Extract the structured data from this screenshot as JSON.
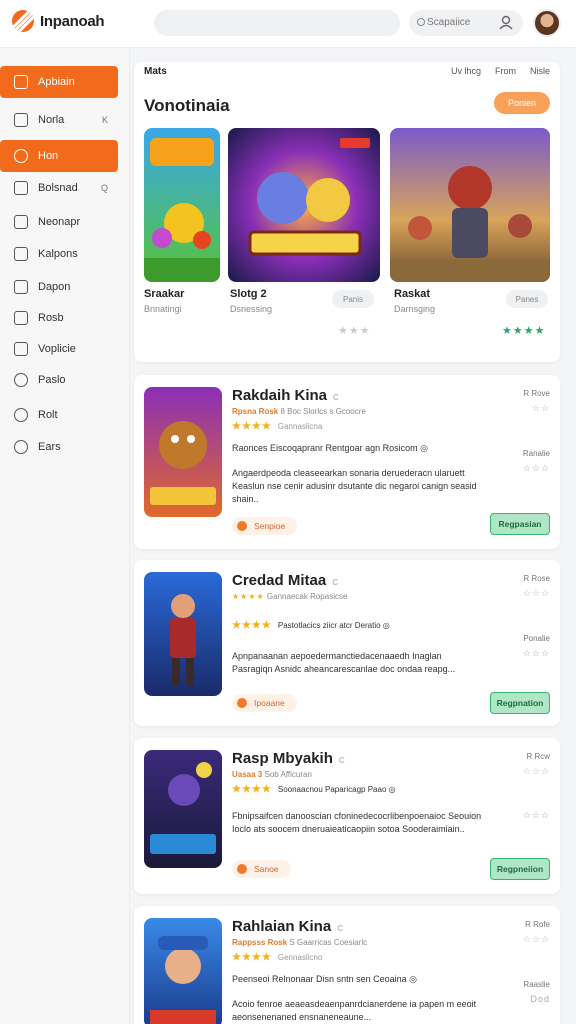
{
  "header": {
    "app_title": "Inpanoah",
    "search_placeholder": "Scapaiice"
  },
  "sidebar": {
    "items": [
      {
        "label": "Apbiain",
        "icon": "home-icon",
        "active": true,
        "sub": ""
      },
      {
        "label": "Norla",
        "icon": "grid-icon",
        "active": false,
        "sub": "K"
      },
      {
        "label": "Hon",
        "icon": "game-icon",
        "active": true,
        "sub": ""
      },
      {
        "label": "Bolsnad",
        "icon": "folder-icon",
        "active": false,
        "sub": "Q"
      },
      {
        "label": "Neonapr",
        "icon": "document-icon",
        "active": false,
        "sub": ""
      },
      {
        "label": "Kalpons",
        "icon": "puzzle-icon",
        "active": false,
        "sub": ""
      },
      {
        "label": "Dapon",
        "icon": "chat-icon",
        "active": false,
        "sub": ""
      },
      {
        "label": "Rosb",
        "icon": "chart-icon",
        "active": false,
        "sub": ""
      },
      {
        "label": "Voplicie",
        "icon": "square-icon",
        "active": false,
        "sub": ""
      },
      {
        "label": "Paslo",
        "icon": "camera-icon",
        "active": false,
        "sub": ""
      },
      {
        "label": "Rolt",
        "icon": "circle-icon",
        "active": false,
        "sub": ""
      },
      {
        "label": "Ears",
        "icon": "settings-icon",
        "active": false,
        "sub": ""
      }
    ]
  },
  "featured": {
    "nav_left": "Mats",
    "nav_right": [
      "Uv lhcg",
      "From",
      "Nisle"
    ],
    "title": "Vonotinaia",
    "button": "Ponien",
    "tiles": [
      {
        "name": "Sraakar",
        "sub": "Bnnatingi",
        "tag": "",
        "stars": ""
      },
      {
        "name": "Slotg 2",
        "sub": "Dsnessing",
        "tag": "Panis",
        "stars": "★★★"
      },
      {
        "name": "Raskat",
        "sub": "Darnsging",
        "tag": "Panes",
        "stars": "★★★★"
      }
    ]
  },
  "cards": [
    {
      "title": "Rakdaih Kina",
      "title_tag": "C",
      "meta_accent": "Rpsna Rosk",
      "meta_rest": "8  Boc Slorlcs  s Gcoocre",
      "rating": "★★★★",
      "rating_label": "Gannaslicna",
      "line": "Raonces Eiscoqapranr Rentgoar agn Rosicom ◎",
      "desc": "Angaerdpeoda cleaseearkan sonaria deruederacn ularuett Keaslun nse cenir adusinr dsutante dic negaroi canign seasid shain..",
      "chip": "Senpioe",
      "right1": "R Rove",
      "right1_stars": "☆☆",
      "right2": "Ranalie",
      "right2_stars": "☆☆☆",
      "cta": "Regpasian"
    },
    {
      "title": "Credad Mitaa",
      "title_tag": "C",
      "meta_accent": "",
      "meta_rest": "Gannaecak    Ropasicse",
      "rating": "★★★★",
      "rating_label": "Pastotlacics ziicr atcr  Deratio ◎",
      "line": "",
      "desc": "Apnpanaanan aepoedermanctiedacenaaedh Inaglan Pasragiqn Asnidc aheancarescanlae doc ondaa reapg...",
      "chip": "Ipoaane",
      "right1": "R Rose",
      "right1_stars": "☆☆☆",
      "right2": "Ponalie",
      "right2_stars": "☆☆☆",
      "cta": "Regpnation"
    },
    {
      "title": "Rasp Mbyakih",
      "title_tag": "C",
      "meta_accent": "Uasaa 3",
      "meta_rest": "Sob Afficuran",
      "rating": "★★★★",
      "rating_label": "Soonaacnou  Paparicagp Paao ◎",
      "line": "",
      "desc": "Fbnipsaifcen danooscian cfoninedecocrlibenpoenaioc Seouion Ioclo ats soocem dneruaieaticaopiin sotoa Sooderaimiain..",
      "chip": "Sanoe",
      "right1": "R Rcw",
      "right1_stars": "☆☆☆",
      "right2": "",
      "right2_stars": "☆☆☆",
      "cta": "Regpneiion"
    },
    {
      "title": "Rahlaian Kina",
      "title_tag": "C",
      "meta_accent": "Rappsss Rosk",
      "meta_rest": "S Gaarricas    Coesiarlc",
      "rating": "★★★★",
      "rating_label": "Gennaslicno",
      "line": "Peenseoi Relnonaar Disn sntn sen Ceoaina ◎",
      "desc": "Acoio fenroe aeaeasdeaenpanrdcianerdene ia papen m eeoit aeonsenenaned ensnaneneaune...",
      "chip": "",
      "right1": "R Rofe",
      "right1_stars": "☆☆☆",
      "right2": "Raaslie",
      "right2_stars": "Dod",
      "cta": ""
    }
  ]
}
